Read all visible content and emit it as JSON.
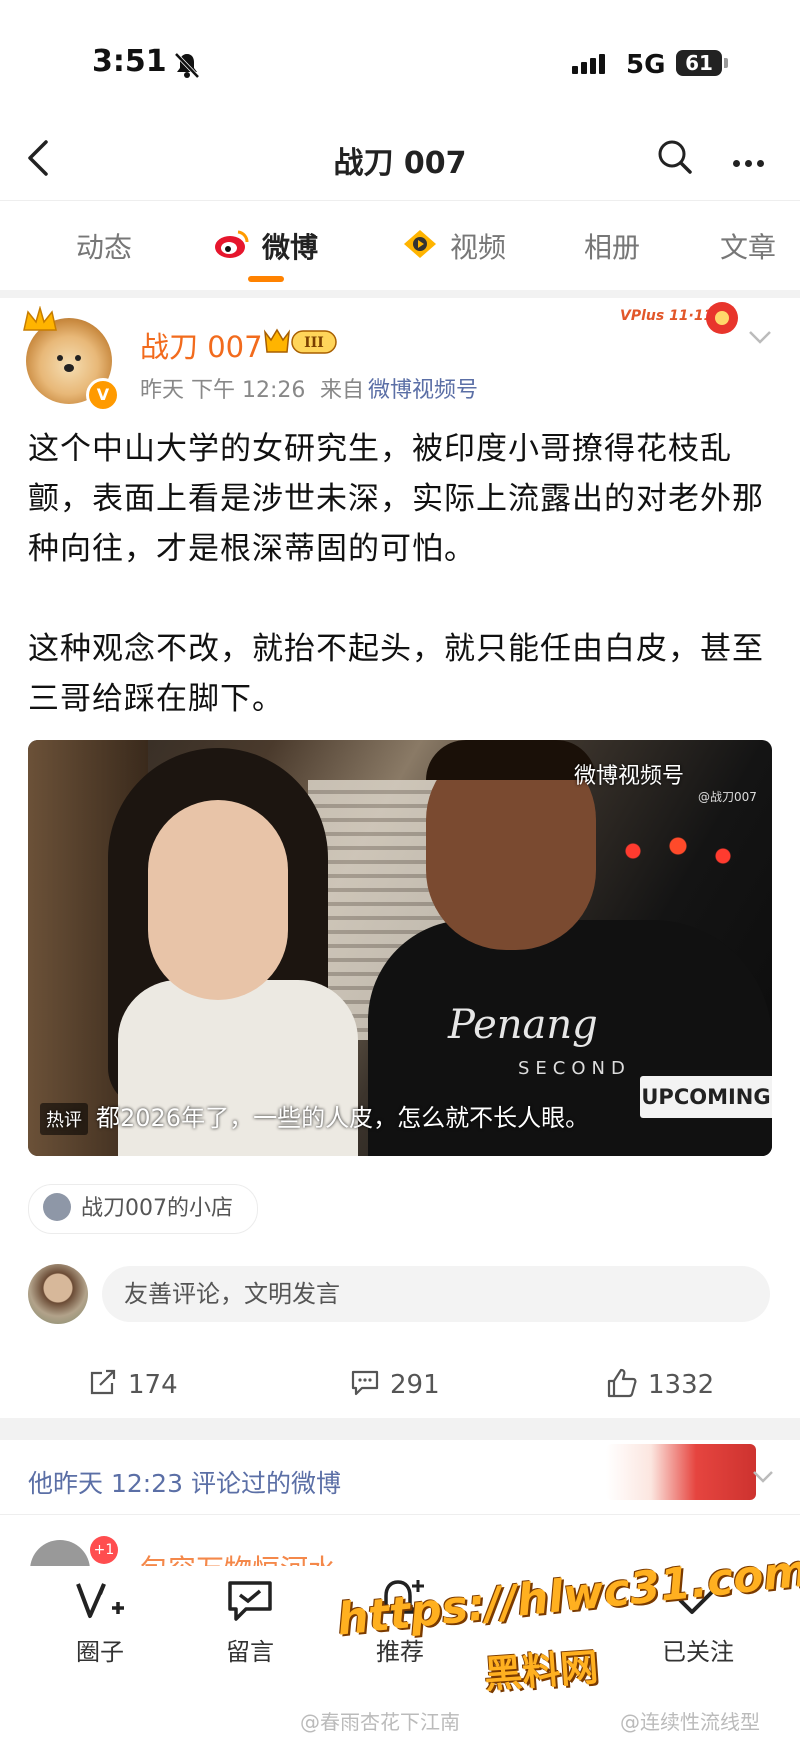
{
  "status": {
    "time": "3:51",
    "network": "5G",
    "battery": "61"
  },
  "nav": {
    "title": "战刀 007"
  },
  "tabs": [
    {
      "label": "动态"
    },
    {
      "label": "微博"
    },
    {
      "label": "视频"
    },
    {
      "label": "相册"
    },
    {
      "label": "文章"
    }
  ],
  "post": {
    "author": "战刀 007",
    "vip_level": "III",
    "time": "昨天 下午 12:26",
    "source_prefix": "来自",
    "source": "微博视频号",
    "vplus_label": "VPlus 11·11",
    "paragraphs": [
      "这个中山大学的女研究生，被印度小哥撩得花枝乱颤，表面上看是涉世未深，实际上流露出的对老外那种向往，才是根深蒂固的可怕。",
      "这种观念不改，就抬不起头，就只能任由白皮，甚至三哥给踩在脚下。"
    ],
    "video": {
      "watermark": "微博视频号",
      "handle": "@战刀007",
      "shirt_text": "Penang",
      "shirt_sub": "SECOND",
      "upcoming": "UPCOMING",
      "hot_tag": "热评",
      "hot_comment": "都2026年了，一些的人皮，怎么就不长人眼。"
    },
    "shop": "战刀007的小店",
    "comment_placeholder": "友善评论，文明发言",
    "reposts": "174",
    "comments": "291",
    "likes": "1332"
  },
  "history": {
    "text": "他昨天 12:23 评论过的微博",
    "next_badge": "+1",
    "next_name": "包容万物恒河水"
  },
  "bottom": {
    "circle": "圈子",
    "message": "留言",
    "recommend": "推荐",
    "followed": "已关注"
  },
  "watermarks": {
    "site": "https://hlwc31.com",
    "site_cn": "黑料网",
    "footer_left": "@春雨杏花下江南",
    "footer_right": "@连续性流线型"
  }
}
